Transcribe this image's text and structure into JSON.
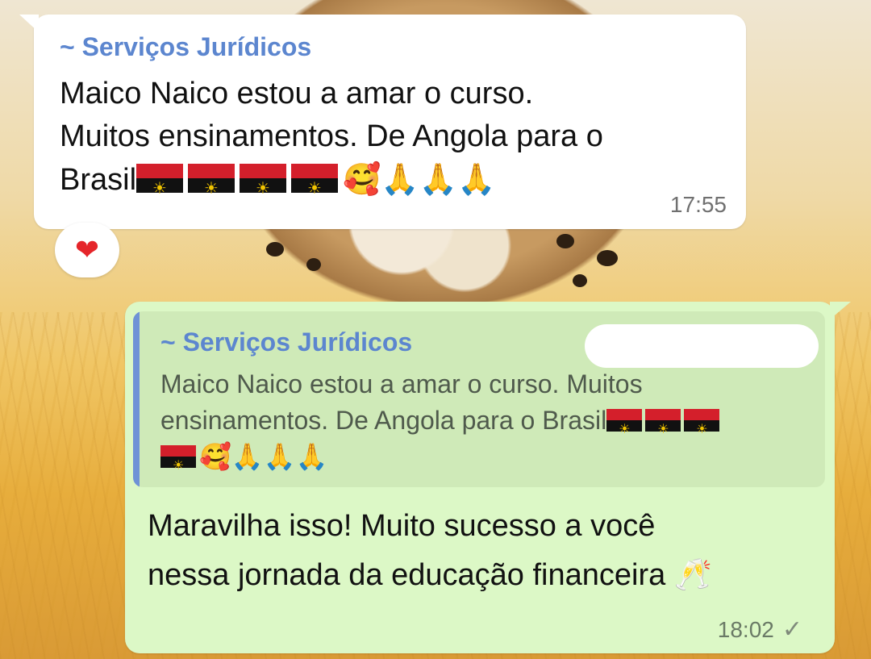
{
  "incoming": {
    "sender": "~ Serviços Jurídicos",
    "text_line1": "Maico Naico estou a amar o curso.",
    "text_line2": "Muitos ensinamentos. De Angola para o",
    "text_line3": "Brasil",
    "emoji_tail": "🥰🙏🙏🙏",
    "time": "17:55",
    "reaction": "❤"
  },
  "outgoing": {
    "quote_sender": "~ Serviços Jurídicos",
    "quote_line1": "Maico Naico estou a amar o curso. Muitos",
    "quote_line2": "ensinamentos. De Angola para o Brasil",
    "quote_emoji_tail": "🥰🙏🙏🙏",
    "text_line1": "Maravilha isso! Muito sucesso a você",
    "text_line2": "nessa jornada da educação financeira",
    "emoji_end": "🥂",
    "time": "18:02",
    "status": "✓"
  }
}
